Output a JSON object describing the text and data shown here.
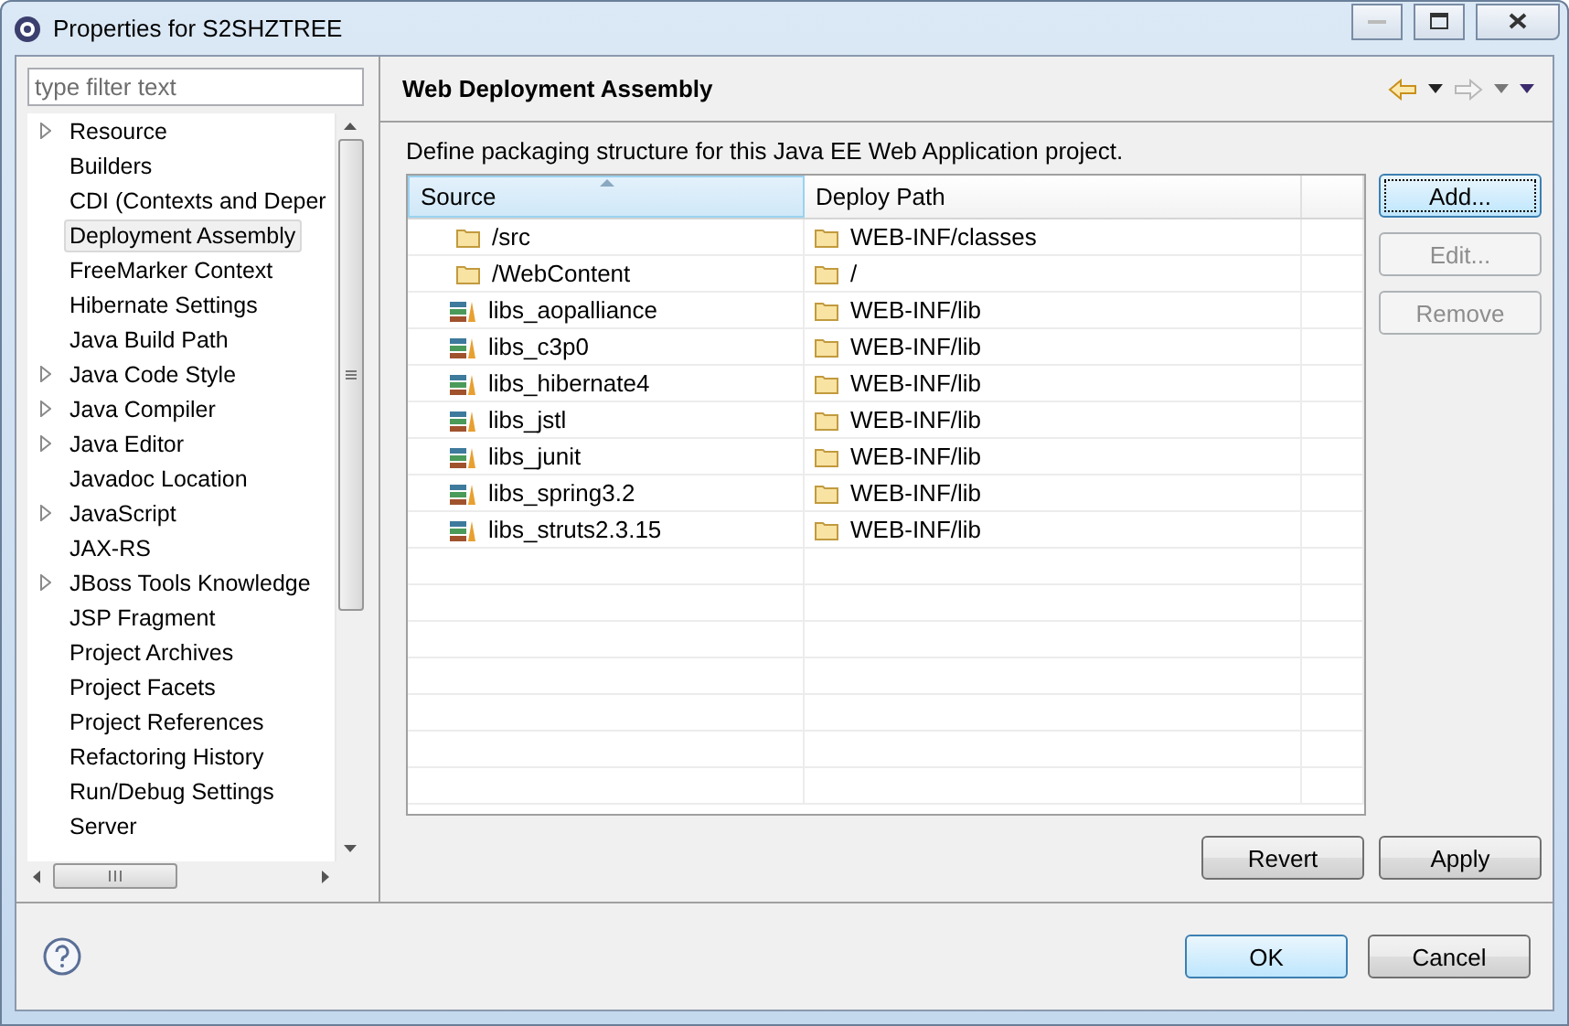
{
  "window": {
    "title": "Properties for S2SHZTREE"
  },
  "filter": {
    "placeholder": "type filter text"
  },
  "tree": [
    {
      "label": "Resource",
      "expandable": true,
      "selected": false
    },
    {
      "label": "Builders",
      "expandable": false,
      "selected": false
    },
    {
      "label": "CDI (Contexts and Deper",
      "expandable": false,
      "selected": false
    },
    {
      "label": "Deployment Assembly",
      "expandable": false,
      "selected": true
    },
    {
      "label": "FreeMarker Context",
      "expandable": false,
      "selected": false
    },
    {
      "label": "Hibernate Settings",
      "expandable": false,
      "selected": false
    },
    {
      "label": "Java Build Path",
      "expandable": false,
      "selected": false
    },
    {
      "label": "Java Code Style",
      "expandable": true,
      "selected": false
    },
    {
      "label": "Java Compiler",
      "expandable": true,
      "selected": false
    },
    {
      "label": "Java Editor",
      "expandable": true,
      "selected": false
    },
    {
      "label": "Javadoc Location",
      "expandable": false,
      "selected": false
    },
    {
      "label": "JavaScript",
      "expandable": true,
      "selected": false
    },
    {
      "label": "JAX-RS",
      "expandable": false,
      "selected": false
    },
    {
      "label": "JBoss Tools Knowledge",
      "expandable": true,
      "selected": false
    },
    {
      "label": "JSP Fragment",
      "expandable": false,
      "selected": false
    },
    {
      "label": "Project Archives",
      "expandable": false,
      "selected": false
    },
    {
      "label": "Project Facets",
      "expandable": false,
      "selected": false
    },
    {
      "label": "Project References",
      "expandable": false,
      "selected": false
    },
    {
      "label": "Refactoring History",
      "expandable": false,
      "selected": false
    },
    {
      "label": "Run/Debug Settings",
      "expandable": false,
      "selected": false
    },
    {
      "label": "Server",
      "expandable": false,
      "selected": false
    }
  ],
  "page": {
    "title": "Web Deployment Assembly",
    "description": "Define packaging structure for this Java EE Web Application project."
  },
  "table": {
    "columns": [
      "Source",
      "Deploy Path"
    ],
    "rows": [
      {
        "kind": "folder",
        "source": "/src",
        "deploy_path": "WEB-INF/classes"
      },
      {
        "kind": "folder",
        "source": "/WebContent",
        "deploy_path": "/"
      },
      {
        "kind": "library",
        "source": "libs_aopalliance",
        "deploy_path": "WEB-INF/lib"
      },
      {
        "kind": "library",
        "source": "libs_c3p0",
        "deploy_path": "WEB-INF/lib"
      },
      {
        "kind": "library",
        "source": "libs_hibernate4",
        "deploy_path": "WEB-INF/lib"
      },
      {
        "kind": "library",
        "source": "libs_jstl",
        "deploy_path": "WEB-INF/lib"
      },
      {
        "kind": "library",
        "source": "libs_junit",
        "deploy_path": "WEB-INF/lib"
      },
      {
        "kind": "library",
        "source": "libs_spring3.2",
        "deploy_path": "WEB-INF/lib"
      },
      {
        "kind": "library",
        "source": "libs_struts2.3.15",
        "deploy_path": "WEB-INF/lib"
      }
    ]
  },
  "side_buttons": [
    {
      "label": "Add...",
      "disabled": false,
      "focused": true
    },
    {
      "label": "Edit...",
      "disabled": true,
      "focused": false
    },
    {
      "label": "Remove",
      "disabled": true,
      "focused": false
    }
  ],
  "page_buttons": [
    "Revert",
    "Apply"
  ],
  "dialog_buttons": [
    {
      "label": "OK",
      "default": true
    },
    {
      "label": "Cancel",
      "default": false
    }
  ]
}
